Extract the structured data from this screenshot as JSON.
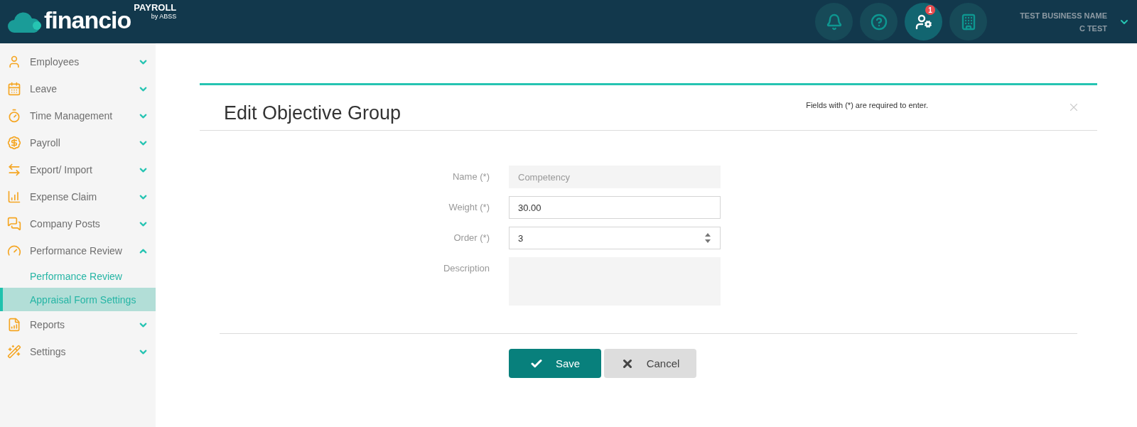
{
  "header": {
    "logo": {
      "wordmark": "financio",
      "product": "PAYROLL",
      "vendor": "by ABSS"
    },
    "icon_buttons": [
      {
        "selected": false
      },
      {
        "selected": false
      },
      {
        "selected": true,
        "badge": "1"
      },
      {
        "selected": false
      }
    ],
    "account": {
      "business": "TEST BUSINESS NAME",
      "user": "C TEST"
    }
  },
  "sidebar": {
    "items": [
      {
        "label": "Employees",
        "expanded": false
      },
      {
        "label": "Leave",
        "expanded": false
      },
      {
        "label": "Time Management",
        "expanded": false
      },
      {
        "label": "Payroll",
        "expanded": false
      },
      {
        "label": "Export/ Import",
        "expanded": false
      },
      {
        "label": "Expense Claim",
        "expanded": false
      },
      {
        "label": "Company Posts",
        "expanded": false
      },
      {
        "label": "Performance Review",
        "expanded": true,
        "children": [
          {
            "label": "Performance Review",
            "selected": false
          },
          {
            "label": "Appraisal Form Settings",
            "selected": true
          }
        ]
      },
      {
        "label": "Reports",
        "expanded": false
      },
      {
        "label": "Settings",
        "expanded": false
      }
    ]
  },
  "dialog": {
    "title": "Edit Objective Group",
    "note": "Fields with (*) are required to enter.",
    "fields": [
      {
        "kind": "readonly",
        "label": "Name (*)",
        "value": "Competency"
      },
      {
        "kind": "text",
        "label": "Weight (*)",
        "value": "30.00"
      },
      {
        "kind": "number",
        "label": "Order (*)",
        "value": "3"
      },
      {
        "kind": "textarea",
        "label": "Description"
      }
    ],
    "buttons": [
      {
        "kind": "save",
        "label": "Save"
      },
      {
        "kind": "cancel",
        "label": "Cancel"
      }
    ]
  }
}
